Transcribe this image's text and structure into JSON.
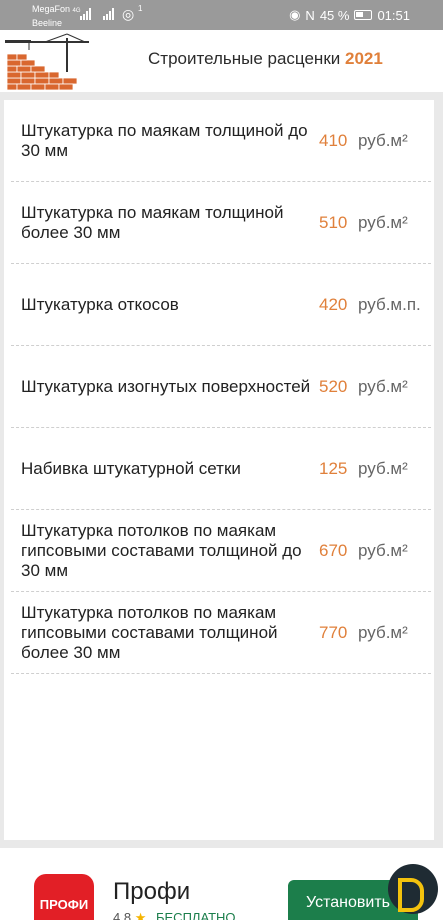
{
  "status": {
    "carrier1": "MegaFon",
    "carrier1_net": "4G",
    "carrier2": "Beeline",
    "wifi_badge": "1",
    "nfc": "N",
    "battery": "45 %",
    "time": "01:51"
  },
  "header": {
    "title": "Строительные расценки",
    "year": "2021"
  },
  "items": [
    {
      "name": "Штукатурка по маякам толщиной до 30 мм",
      "price": "410",
      "unit": "руб.м²"
    },
    {
      "name": "Штукатурка по маякам толщиной более 30 мм",
      "price": "510",
      "unit": "руб.м²"
    },
    {
      "name": "Штукатурка откосов",
      "price": "420",
      "unit": "руб.м.п."
    },
    {
      "name": "Штукатурка изогнутых поверхностей",
      "price": "520",
      "unit": "руб.м²"
    },
    {
      "name": "Набивка штукатурной сетки",
      "price": "125",
      "unit": "руб.м²"
    },
    {
      "name": "Штукатурка потолков по маякам гипсовыми составами толщиной до 30 мм",
      "price": "670",
      "unit": "руб.м²"
    },
    {
      "name": "Штукатурка потолков по маякам гипсовыми составами толщиной более 30 мм",
      "price": "770",
      "unit": "руб.м²"
    }
  ],
  "ad": {
    "logo_text": "ПРОФИ",
    "title": "Профи",
    "rating": "4.8",
    "free": "БЕСПЛАТНО",
    "button": "Установить"
  }
}
